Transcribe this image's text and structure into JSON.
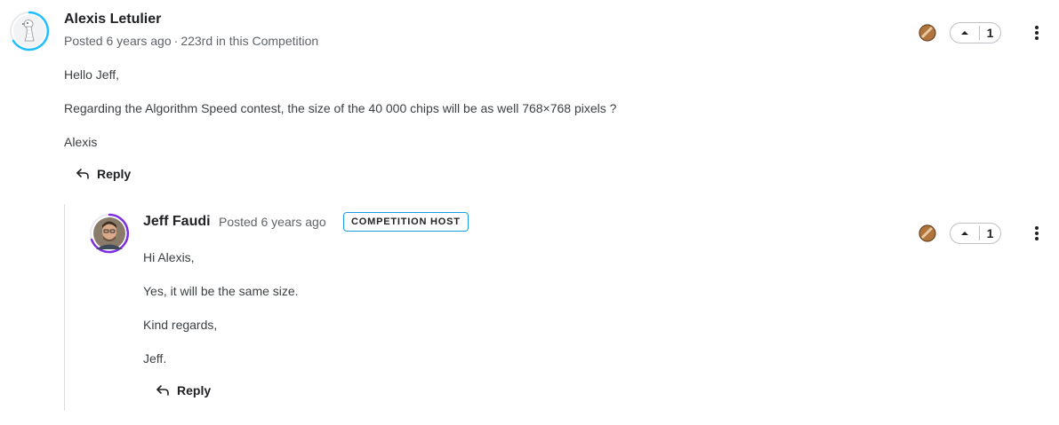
{
  "top_comment": {
    "author": "Alexis Letulier",
    "posted": "Posted 6 years ago",
    "separator": "·",
    "rank": "223rd in this Competition",
    "paragraphs": [
      "Hello Jeff,",
      "Regarding the Algorithm Speed contest, the size of the 40 000 chips will be as well 768×768 pixels ?",
      "Alexis"
    ],
    "reply_label": "Reply",
    "votes": "1",
    "medal": "bronze-medal-icon",
    "avatar_ring_color": "#20beff"
  },
  "reply_comment": {
    "author": "Jeff Faudi",
    "posted": "Posted 6 years ago",
    "badge": "COMPETITION HOST",
    "paragraphs": [
      "Hi Alexis,",
      "Yes, it will be the same size.",
      "Kind regards,",
      "Jeff."
    ],
    "reply_label": "Reply",
    "votes": "1",
    "medal": "bronze-medal-icon",
    "avatar_ring_color": "#7b2fe0"
  },
  "colors": {
    "badge_border": "#1a9ee1",
    "medal_bronze": "#b0753d"
  }
}
